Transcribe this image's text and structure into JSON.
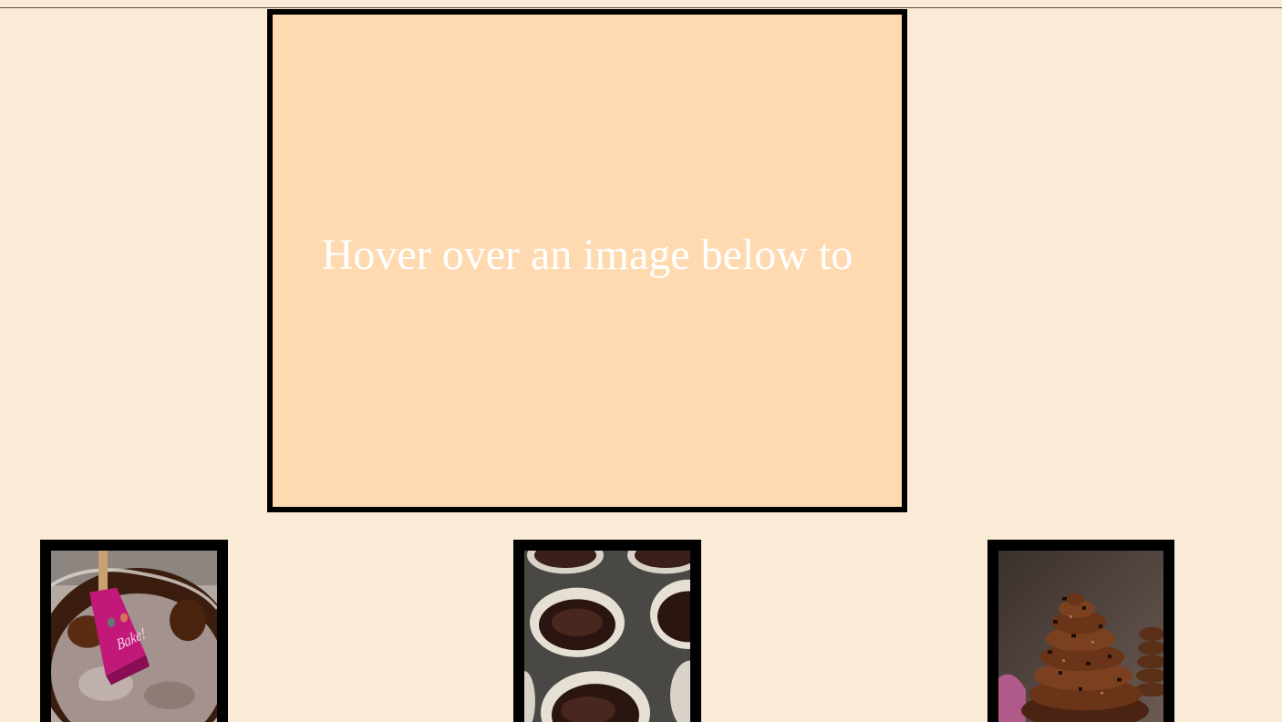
{
  "preview": {
    "text": "Hover over an image below to"
  },
  "gallery": {
    "thumbnails": [
      {
        "subject": "chocolate batter in glass bowl with pink spatula",
        "spatula_text": "Bake!"
      },
      {
        "subject": "chocolate batter in cupcake liners in muffin tin"
      },
      {
        "subject": "chocolate cupcake with swirled frosting and chocolate shavings"
      }
    ]
  },
  "colors": {
    "page_background": "#faebd7",
    "preview_background": "#ffdab0",
    "frame": "#000000",
    "preview_text": "#ffffff"
  }
}
